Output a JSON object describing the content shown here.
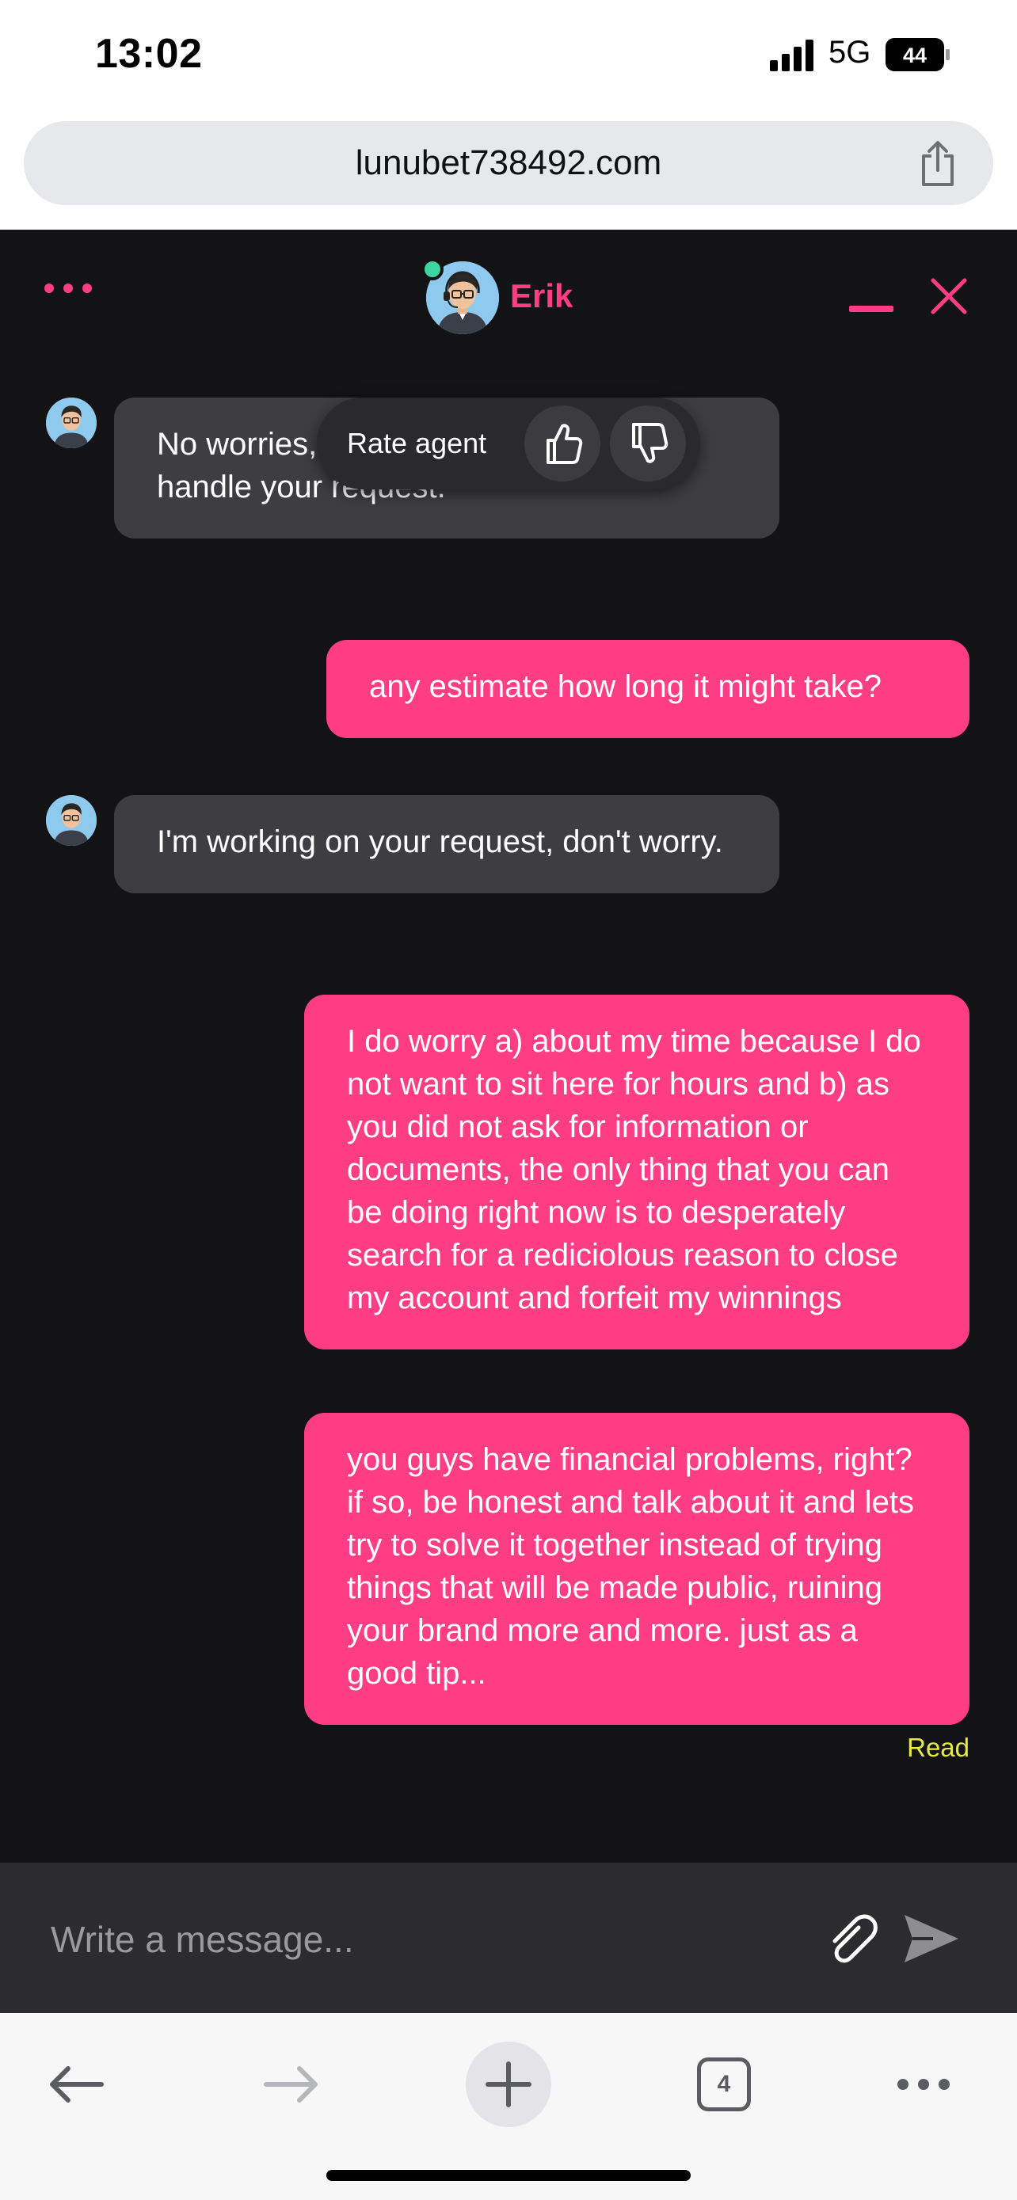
{
  "status_bar": {
    "time": "13:02",
    "network": "5G",
    "battery": "44"
  },
  "browser": {
    "url": "lunubet738492.com",
    "tab_count": "4"
  },
  "chat": {
    "agent_name": "Erik",
    "rate_popup": {
      "label": "Rate agent"
    },
    "messages": [
      {
        "from": "agent",
        "text": "No worries, I need some more time to handle your request."
      },
      {
        "from": "user",
        "text": "any estimate how long it might take?"
      },
      {
        "from": "agent",
        "text": "I'm working on your request, don't worry."
      },
      {
        "from": "user",
        "text": "I do worry a) about my time because I do not want to sit here for hours and b) as you did not ask for information or documents, the only thing that you can be doing right now is to desperately search for a rediciolous reason to close my account and forfeit my winnings"
      },
      {
        "from": "user",
        "text": "you guys have financial problems, right? if so, be honest and talk about it and lets try to solve it together instead of trying things that will be made public, ruining your brand more and more. just as a good tip..."
      }
    ],
    "read_receipt": "Read",
    "composer": {
      "placeholder": "Write a message..."
    }
  },
  "colors": {
    "accent": "#ff3d84",
    "chat_bg": "#131315",
    "agent_bubble": "#3e3e41",
    "read_receipt": "#e6ec3c",
    "online": "#3ed6a0"
  },
  "icons": [
    "share-icon",
    "menu-dots-icon",
    "minimize-icon",
    "close-icon",
    "thumbs-up-icon",
    "thumbs-down-icon",
    "paperclip-icon",
    "send-icon",
    "back-arrow-icon",
    "forward-arrow-icon",
    "plus-icon",
    "tabs-icon",
    "more-icon"
  ]
}
